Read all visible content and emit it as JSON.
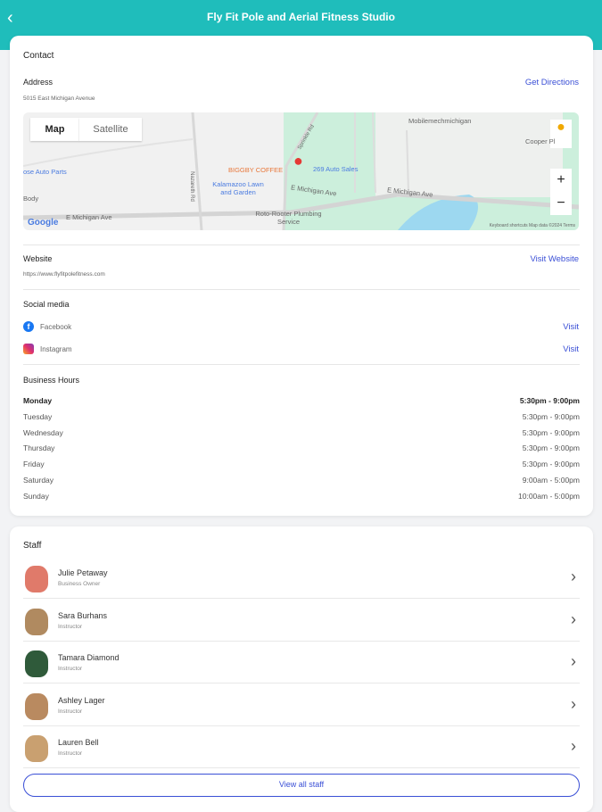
{
  "header": {
    "title": "Fly Fit Pole and Aerial Fitness Studio",
    "back_icon": "‹"
  },
  "contact": {
    "title": "Contact",
    "address_label": "Address",
    "address": "5015 East Michigan Avenue",
    "get_directions": "Get Directions",
    "map": {
      "tab_map": "Map",
      "tab_satellite": "Satellite",
      "zoom_in": "+",
      "zoom_out": "−",
      "google": "Google",
      "footer": "Keyboard shortcuts   Map data ©2024   Terms",
      "labels": {
        "biggby": "BIGGBY COFFEE",
        "auto_sales": "269 Auto Sales",
        "lawn": "Kalamazoo Lawn and Garden",
        "roto": "Roto-Rooter Plumbing Service",
        "auto_parts": "ose Auto Parts",
        "body": "Body",
        "mich1": "E Michigan Ave",
        "mich2": "E Michigan Ave",
        "mich3": "E Michigan Ave",
        "mobile": "Mobilemechmichigan",
        "cooper": "Cooper Pl",
        "sprinkle": "Sprinkle Rd",
        "nazareth": "Nazareth Rd"
      }
    },
    "website_label": "Website",
    "website_url": "https://www.flyfitpolefitness.com",
    "visit_website": "Visit Website",
    "social_label": "Social media",
    "facebook": "Facebook",
    "instagram": "Instagram",
    "visit": "Visit",
    "hours_label": "Business Hours",
    "hours": [
      {
        "day": "Monday",
        "time": "5:30pm - 9:00pm"
      },
      {
        "day": "Tuesday",
        "time": "5:30pm - 9:00pm"
      },
      {
        "day": "Wednesday",
        "time": "5:30pm - 9:00pm"
      },
      {
        "day": "Thursday",
        "time": "5:30pm - 9:00pm"
      },
      {
        "day": "Friday",
        "time": "5:30pm - 9:00pm"
      },
      {
        "day": "Saturday",
        "time": "9:00am - 5:00pm"
      },
      {
        "day": "Sunday",
        "time": "10:00am - 5:00pm"
      }
    ]
  },
  "staff": {
    "title": "Staff",
    "view_all": "View all staff",
    "chevron": "›",
    "members": [
      {
        "name": "Julie Petaway",
        "role": "Business Owner"
      },
      {
        "name": "Sara Burhans",
        "role": "Instructor"
      },
      {
        "name": "Tamara Diamond",
        "role": "Instructor"
      },
      {
        "name": "Ashley Lager",
        "role": "Instructor"
      },
      {
        "name": "Lauren Bell",
        "role": "Instructor"
      }
    ]
  },
  "colors": {
    "accent": "#1fbdbb",
    "link": "#3a4fd6"
  }
}
